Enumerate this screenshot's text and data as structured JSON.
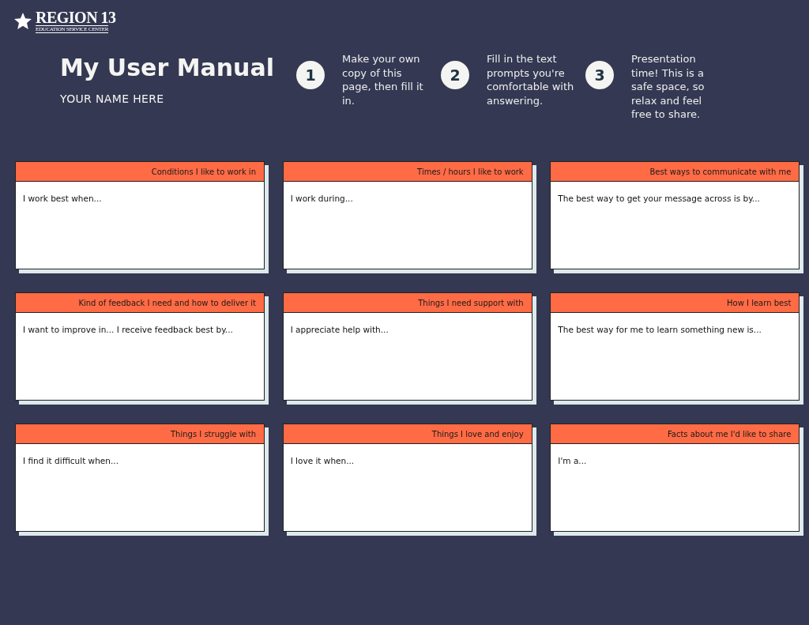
{
  "logo": {
    "name": "REGION 13",
    "subtitle": "EDUCATION SERVICE CENTER"
  },
  "header": {
    "title": "My User Manual",
    "name": "YOUR NAME HERE"
  },
  "steps": [
    {
      "number": "1",
      "text": "Make your own copy of this page, then fill it in."
    },
    {
      "number": "2",
      "text": "Fill in the text prompts you're comfortable with answering."
    },
    {
      "number": "3",
      "text": "Presentation time! This is a safe space, so relax and feel free to share."
    }
  ],
  "cards": [
    {
      "title": "Conditions I like to work in",
      "prompt": "I work best when..."
    },
    {
      "title": "Times / hours I like to work",
      "prompt": "I work during..."
    },
    {
      "title": "Best ways to communicate with me",
      "prompt": "The best way to get your message across is by..."
    },
    {
      "title": "Kind of feedback I need and how to deliver it",
      "prompt": "I want to improve in... I receive feedback best by..."
    },
    {
      "title": "Things I need support with",
      "prompt": "I appreciate help with..."
    },
    {
      "title": "How I learn best",
      "prompt": "The best way for me to learn something new is..."
    },
    {
      "title": "Things I struggle with",
      "prompt": "I find it difficult when..."
    },
    {
      "title": "Things I love and enjoy",
      "prompt": "I love it when..."
    },
    {
      "title": "Facts about me I'd like to share",
      "prompt": "I'm a..."
    }
  ]
}
